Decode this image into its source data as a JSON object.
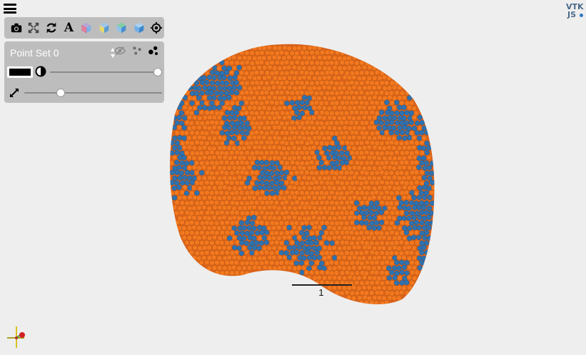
{
  "menu": {
    "icon": "hamburger-menu-icon"
  },
  "toolbar": {
    "buttons": [
      {
        "name": "screenshot",
        "icon": "camera-icon"
      },
      {
        "name": "reset-camera",
        "icon": "fit-view-icon"
      },
      {
        "name": "rotate",
        "icon": "rotate-icon"
      },
      {
        "name": "orientation-labels",
        "icon": "text-a-icon",
        "label": "A"
      },
      {
        "name": "view-x",
        "icon": "cube-x-icon"
      },
      {
        "name": "view-y",
        "icon": "cube-y-icon"
      },
      {
        "name": "view-z",
        "icon": "cube-z-icon"
      },
      {
        "name": "view-iso",
        "icon": "cube-iso-icon"
      },
      {
        "name": "center",
        "icon": "target-icon"
      }
    ]
  },
  "representation": {
    "selected": "Point Set 0",
    "visibility_icon": "eye-slash-icon",
    "render_points_icon": "small-points-icon",
    "render_spheres_icon": "spheres-icon",
    "color": "#000000",
    "opacity": 1.0,
    "point_size": 0.25
  },
  "scale_bar": {
    "label": "1"
  },
  "colors": {
    "orange": "#f4781f",
    "blue": "#2f72b0",
    "panel": "#bdbdbd",
    "background": "#eeeeee"
  },
  "logo": {
    "line1": "VTK",
    "line2": "JS"
  }
}
